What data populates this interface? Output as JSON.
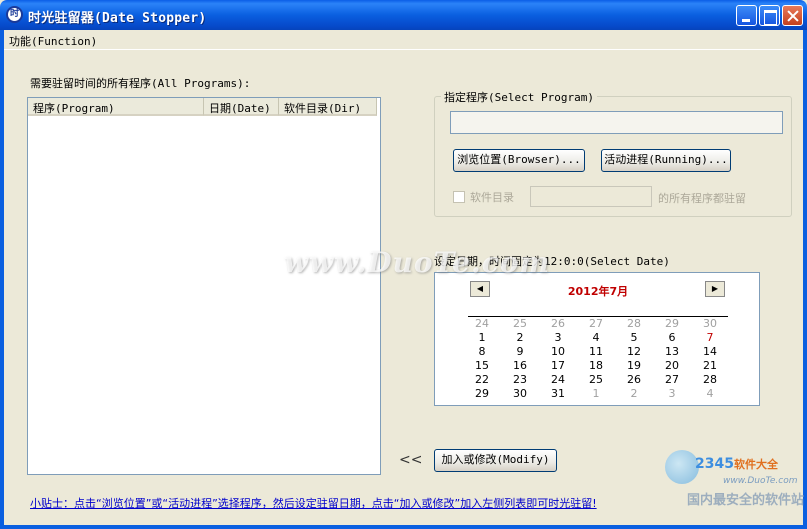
{
  "window": {
    "title": "时光驻留器(Date Stopper)",
    "icon": "clock-app-icon",
    "icon_glyph": "时"
  },
  "menu": {
    "function_label": "功能(Function)"
  },
  "programs": {
    "label": "需要驻留时间的所有程序(All Programs):",
    "columns": [
      "程序(Program)",
      "日期(Date)",
      "软件目录(Dir)"
    ],
    "rows": []
  },
  "select_program": {
    "group_title": "指定程序(Select Program)",
    "path_value": "",
    "browse_label": "浏览位置(Browser)...",
    "running_label": "活动进程(Running)...",
    "dir_checkbox_label": "软件目录",
    "dir_value": "",
    "dir_suffix": "的所有程序都驻留"
  },
  "date": {
    "label": "设定日期，时间固定为12:0:0(Select Date)",
    "month_title": "2012年7月",
    "prev_glyph": "◀",
    "next_glyph": "▶",
    "weeks": [
      [
        {
          "d": "24",
          "o": true
        },
        {
          "d": "25",
          "o": true
        },
        {
          "d": "26",
          "o": true
        },
        {
          "d": "27",
          "o": true
        },
        {
          "d": "28",
          "o": true
        },
        {
          "d": "29",
          "o": true
        },
        {
          "d": "30",
          "o": true
        }
      ],
      [
        {
          "d": "1"
        },
        {
          "d": "2"
        },
        {
          "d": "3"
        },
        {
          "d": "4"
        },
        {
          "d": "5"
        },
        {
          "d": "6"
        },
        {
          "d": "7",
          "t": true
        }
      ],
      [
        {
          "d": "8"
        },
        {
          "d": "9"
        },
        {
          "d": "10"
        },
        {
          "d": "11"
        },
        {
          "d": "12"
        },
        {
          "d": "13"
        },
        {
          "d": "14"
        }
      ],
      [
        {
          "d": "15"
        },
        {
          "d": "16"
        },
        {
          "d": "17"
        },
        {
          "d": "18"
        },
        {
          "d": "19"
        },
        {
          "d": "20"
        },
        {
          "d": "21"
        }
      ],
      [
        {
          "d": "22"
        },
        {
          "d": "23"
        },
        {
          "d": "24"
        },
        {
          "d": "25"
        },
        {
          "d": "26"
        },
        {
          "d": "27"
        },
        {
          "d": "28"
        }
      ],
      [
        {
          "d": "29"
        },
        {
          "d": "30"
        },
        {
          "d": "31"
        },
        {
          "d": "1",
          "o": true
        },
        {
          "d": "2",
          "o": true
        },
        {
          "d": "3",
          "o": true
        },
        {
          "d": "4",
          "o": true
        }
      ]
    ]
  },
  "actions": {
    "arrows": "<<",
    "modify_label": "加入或修改(Modify)"
  },
  "tip": "小贴士：点击“浏览位置”或“活动进程”选择程序，然后设定驻留日期，点击“加入或修改”加入左侧列表即可时光驻留!",
  "watermarks": {
    "duote": "www.DuoTe.com",
    "brand_num": "2345",
    "brand_text": "软件大全",
    "brand_url": "www.DuoTe.com",
    "brand_slogan": "国内最安全的软件站"
  },
  "colors": {
    "title_bar": "#0a5fe0",
    "month_title": "#c00000",
    "tip_link": "#0000cc"
  }
}
